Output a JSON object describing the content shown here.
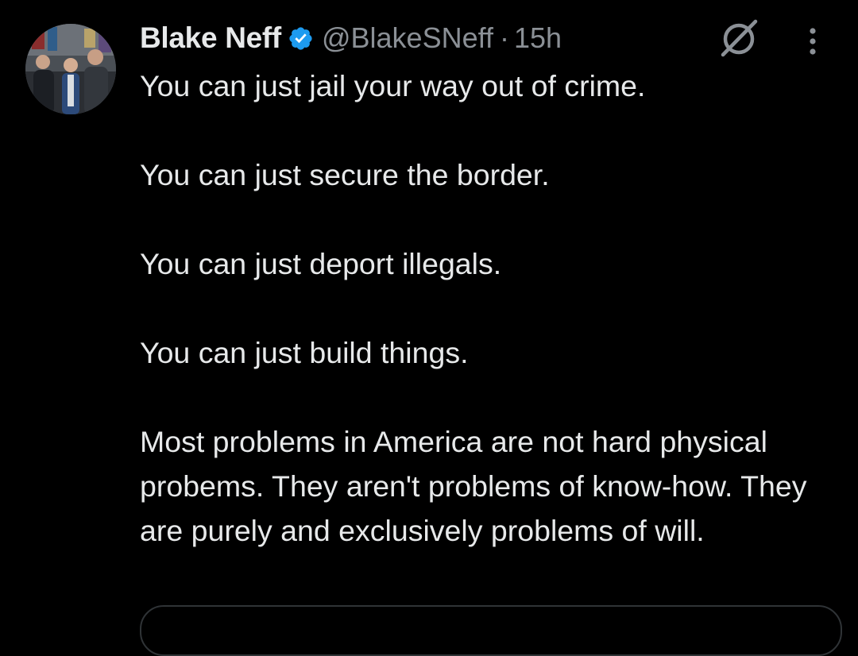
{
  "tweet": {
    "author_name": "Blake Neff",
    "handle": "@BlakeSNeff",
    "separator": "·",
    "time": "15h",
    "verified_icon": "verified-badge-icon",
    "verified_color": "#1d9bf0",
    "grok_icon": "grok-icon",
    "more_icon": "more-options-icon",
    "avatar_icon": "profile-photo",
    "paragraphs": [
      "You can just jail your way out of crime.",
      "You can just secure the border.",
      "You can just deport illegals.",
      "You can just build things.",
      "Most problems in America are not hard physical probems. They aren't problems of know-how. They are purely and exclusively problems of will."
    ]
  },
  "colors": {
    "background": "#000000",
    "text_primary": "#e7e9ea",
    "text_secondary": "#8b9096",
    "border": "#2f3336"
  }
}
